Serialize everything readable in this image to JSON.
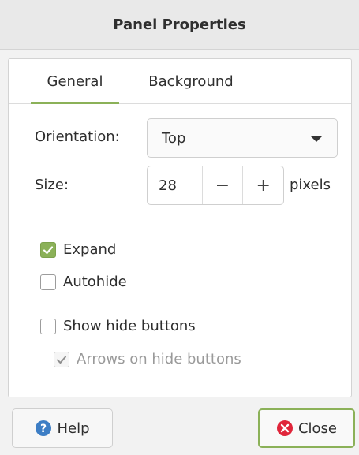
{
  "window": {
    "title": "Panel Properties"
  },
  "tabs": [
    {
      "label": "General",
      "selected": true
    },
    {
      "label": "Background",
      "selected": false
    }
  ],
  "orientation": {
    "label": "Orientation:",
    "value": "Top"
  },
  "size": {
    "label": "Size:",
    "value": "28",
    "unit": "pixels",
    "decrement": "−",
    "increment": "+"
  },
  "options": {
    "expand": {
      "label": "Expand",
      "checked": true
    },
    "autohide": {
      "label": "Autohide",
      "checked": false
    },
    "show_hide_buttons": {
      "label": "Show hide buttons",
      "checked": false
    },
    "arrows_on_hide_buttons": {
      "label": "Arrows on hide buttons",
      "checked": true,
      "disabled": true
    }
  },
  "footer": {
    "help_label": "Help",
    "close_label": "Close"
  },
  "colors": {
    "accent": "#8bb158",
    "help_icon": "#3d7ec5",
    "close_icon": "#e0253a"
  },
  "icons": {
    "help": "help-circle-icon",
    "close": "close-circle-icon",
    "dropdown": "chevron-down-icon",
    "check": "checkmark-icon"
  }
}
